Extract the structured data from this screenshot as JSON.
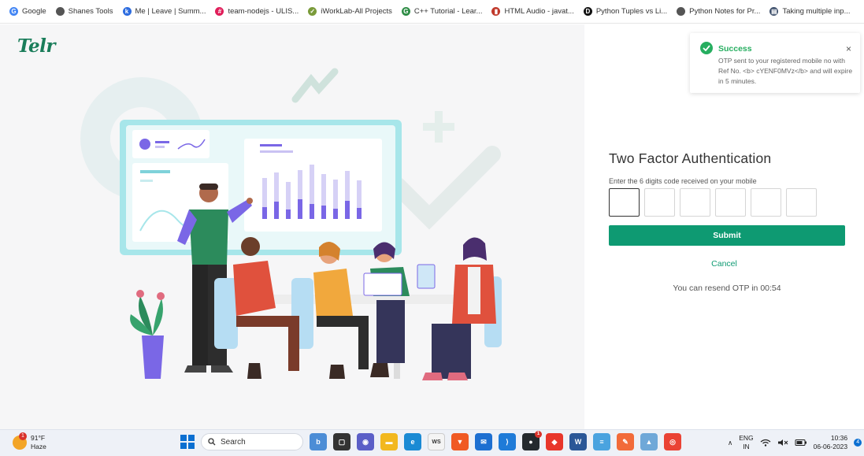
{
  "bookmarks": [
    {
      "label": "Google",
      "icon": "google-icon",
      "color": "#4285f4",
      "glyph": "G"
    },
    {
      "label": "Shanes Tools",
      "icon": "globe-icon",
      "color": "#555555",
      "glyph": ""
    },
    {
      "label": "Me | Leave | Summ...",
      "icon": "keka-icon",
      "color": "#2d6cdf",
      "glyph": "k"
    },
    {
      "label": "team-nodejs - ULIS...",
      "icon": "slack-icon",
      "color": "#e01e5a",
      "glyph": "#"
    },
    {
      "label": "iWorkLab-All Projects",
      "icon": "check-icon",
      "color": "#7a9b3a",
      "glyph": "✓"
    },
    {
      "label": "C++ Tutorial - Lear...",
      "icon": "geeks-icon",
      "color": "#2f8d46",
      "glyph": "G"
    },
    {
      "label": "HTML Audio - javat...",
      "icon": "javatpoint-icon",
      "color": "#c0392b",
      "glyph": "▮"
    },
    {
      "label": "Python Tuples vs Li...",
      "icon": "dev-icon",
      "color": "#111111",
      "glyph": "D"
    },
    {
      "label": "Python Notes for Pr...",
      "icon": "globe-icon",
      "color": "#555555",
      "glyph": ""
    },
    {
      "label": "Taking multiple inp...",
      "icon": "document-icon",
      "color": "#3d4f6b",
      "glyph": "▤"
    }
  ],
  "brand": {
    "logo": "Telr",
    "color": "#1a7d5a"
  },
  "auth": {
    "title": "Two Factor Authentication",
    "subtitle": "Enter the 6 digits code received on your mobile",
    "otp_values": [
      "",
      "",
      "",
      "",
      "",
      ""
    ],
    "submit_label": "Submit",
    "cancel_label": "Cancel",
    "resend_text": "You can resend OTP in 00:54",
    "accent": "#0e9a72"
  },
  "toast": {
    "title": "Success",
    "message": "OTP sent to your registered mobile no with Ref No. <b> cYENF0MVz</b> and will expire in 5 minutes.",
    "close": "×",
    "color": "#27ae60"
  },
  "taskbar": {
    "weather_temp": "91°F",
    "weather_desc": "Haze",
    "weather_badge": "1",
    "search_label": "Search",
    "apps": [
      {
        "name": "copilot-icon",
        "color": "#4c8dd6",
        "glyph": "b"
      },
      {
        "name": "task-view-icon",
        "color": "#333333",
        "glyph": "▢"
      },
      {
        "name": "teams-chat-icon",
        "color": "#5b5fc7",
        "glyph": "◉"
      },
      {
        "name": "file-explorer-icon",
        "color": "#f2b81f",
        "glyph": "▬"
      },
      {
        "name": "edge-icon",
        "color": "#1a8ad4",
        "glyph": "e"
      },
      {
        "name": "ws-icon",
        "color": "#f4f4f4",
        "glyph": "WS"
      },
      {
        "name": "brave-icon",
        "color": "#f05a24",
        "glyph": "▼"
      },
      {
        "name": "mail-icon",
        "color": "#1d6fd1",
        "glyph": "✉"
      },
      {
        "name": "vscode-icon",
        "color": "#1f7bd8",
        "glyph": "⟩"
      },
      {
        "name": "github-icon",
        "color": "#24292e",
        "glyph": "●",
        "badge": "1"
      },
      {
        "name": "anydesk-icon",
        "color": "#e8362b",
        "glyph": "◆"
      },
      {
        "name": "word-icon",
        "color": "#2b5797",
        "glyph": "W"
      },
      {
        "name": "notepad-icon",
        "color": "#4aa3df",
        "glyph": "≡"
      },
      {
        "name": "postman-icon",
        "color": "#f26b3a",
        "glyph": "✎"
      },
      {
        "name": "photos-icon",
        "color": "#6fa8d8",
        "glyph": "▲"
      },
      {
        "name": "chrome-icon",
        "color": "#ea4335",
        "glyph": "◎"
      }
    ],
    "lang_top": "ENG",
    "lang_bottom": "IN",
    "time": "10:36",
    "date": "06-06-2023",
    "notifications": "4"
  }
}
